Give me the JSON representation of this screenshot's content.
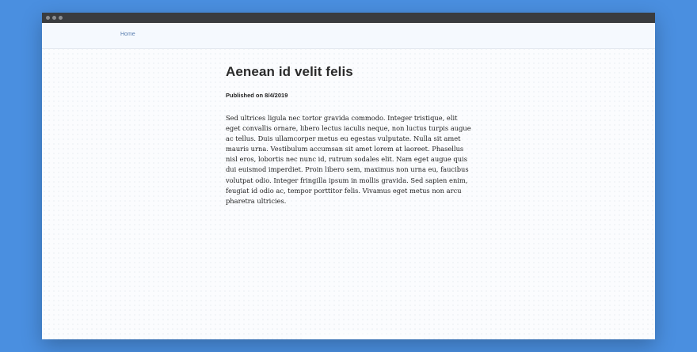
{
  "window": {
    "controls": [
      "close-dot",
      "minimize-dot",
      "zoom-dot"
    ]
  },
  "nav": {
    "home_label": "Home"
  },
  "article": {
    "title": "Aenean id velit felis",
    "published": "Published on 8/4/2019",
    "body": "Sed ultrices ligula nec tortor gravida commodo. Integer tristique, elit eget convallis ornare, libero lectus iaculis neque, non luctus turpis augue ac tellus. Duis ullamcorper metus eu egestas vulputate. Nulla sit amet mauris urna. Vestibulum accumsan sit amet lorem at laoreet. Phasellus nisl eros, lobortis nec nunc id, rutrum sodales elit. Nam eget augue quis dui euismod imperdiet. Proin libero sem, maximus non urna eu, faucibus volutpat odio. Integer fringilla ipsum in mollis gravida. Sed sapien enim, feugiat id odio ac, tempor porttitor felis. Vivamus eget metus non arcu pharetra ultricies."
  },
  "colors": {
    "desktop_background": "#4a8fe0",
    "titlebar": "#3a3c3f",
    "link": "#5a7fb0"
  }
}
